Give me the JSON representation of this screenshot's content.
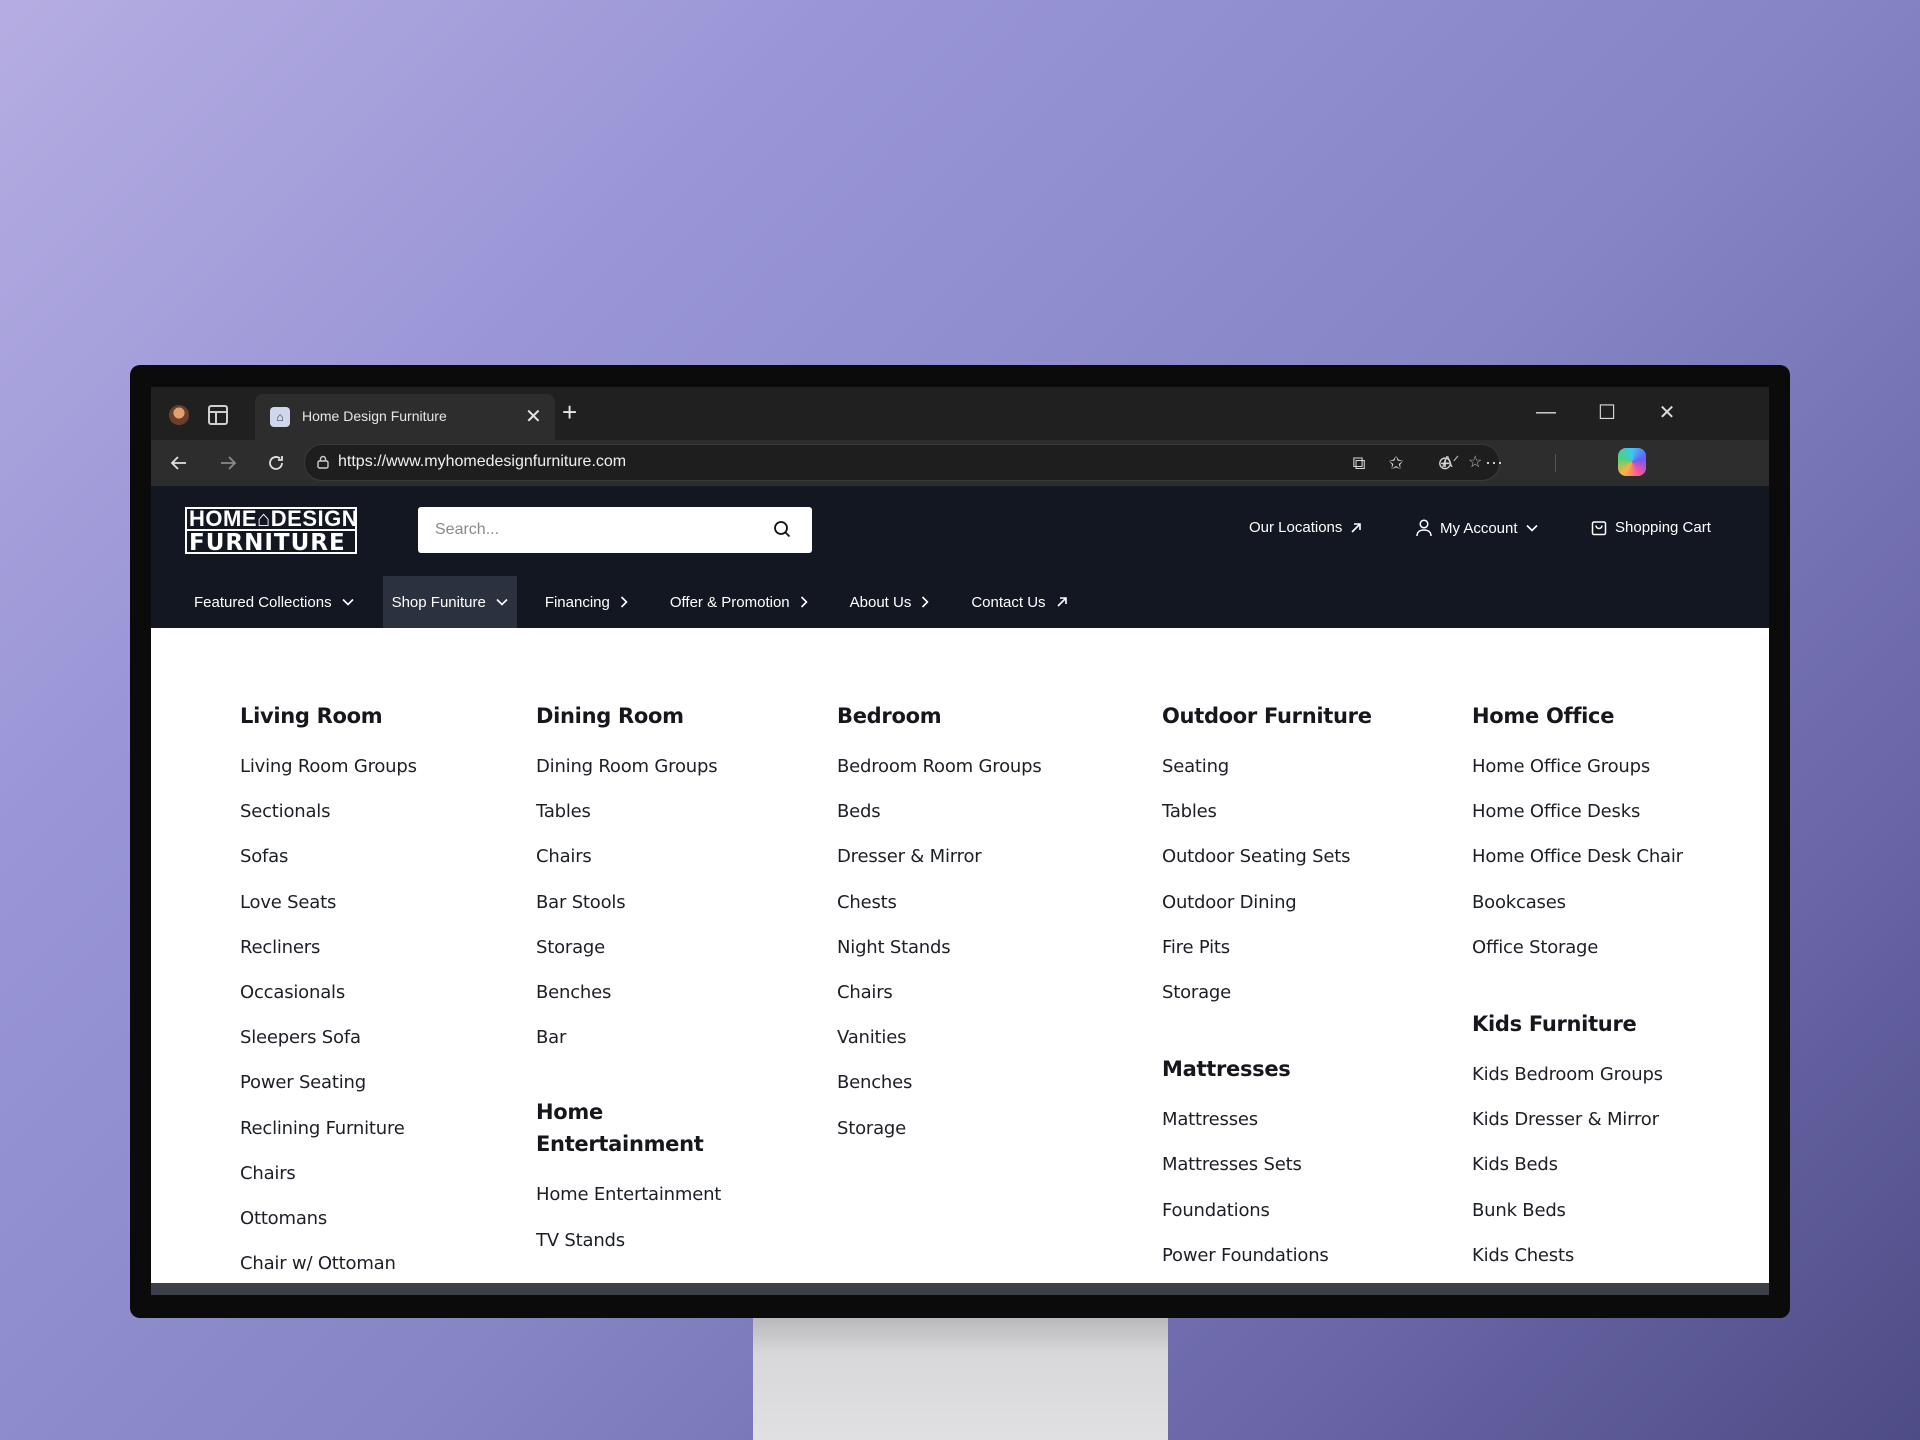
{
  "browser": {
    "tab_title": "Home Design Furniture",
    "url": "https://www.myhomedesignfurniture.com"
  },
  "site": {
    "logo_line1": "HOME⌂DESIGN",
    "logo_line2": "FURNITURE",
    "search_placeholder": "Search...",
    "header_links": {
      "locations": "Our Locations",
      "account": "My Account",
      "cart": "Shopping Cart"
    },
    "nav": [
      {
        "label": "Featured Collections"
      },
      {
        "label": "Shop Funiture"
      },
      {
        "label": "Financing"
      },
      {
        "label": "Offer & Promotion"
      },
      {
        "label": "About Us"
      },
      {
        "label": "Contact Us"
      }
    ]
  },
  "mega_menu": {
    "living_room": {
      "title": "Living Room",
      "items": [
        "Living Room Groups",
        "Sectionals",
        "Sofas",
        "Love Seats",
        "Recliners",
        "Occasionals",
        "Sleepers Sofa",
        "Power Seating",
        "Reclining Furniture",
        "Chairs",
        "Ottomans",
        "Chair w/ Ottoman"
      ]
    },
    "dining_room": {
      "title": "Dining Room",
      "items": [
        "Dining Room Groups",
        "Tables",
        "Chairs",
        "Bar Stools",
        "Storage",
        "Benches",
        "Bar"
      ]
    },
    "home_entertainment": {
      "title_line1": "Home",
      "title_line2": "Entertainment",
      "items": [
        "Home Entertainment",
        "TV Stands"
      ]
    },
    "bedroom": {
      "title": "Bedroom",
      "items": [
        "Bedroom Room Groups",
        "Beds",
        "Dresser & Mirror",
        "Chests",
        "Night Stands",
        "Chairs",
        "Vanities",
        "Benches",
        "Storage"
      ]
    },
    "outdoor": {
      "title": "Outdoor Furniture",
      "items": [
        "Seating",
        "Tables",
        "Outdoor Seating Sets",
        "Outdoor Dining",
        "Fire Pits",
        "Storage"
      ]
    },
    "mattresses": {
      "title": "Mattresses",
      "items": [
        "Mattresses",
        "Mattresses Sets",
        "Foundations",
        "Power Foundations"
      ]
    },
    "home_office": {
      "title": "Home Office",
      "items": [
        "Home Office Groups",
        "Home Office Desks",
        "Home Office Desk Chair",
        "Bookcases",
        "Office Storage"
      ]
    },
    "kids": {
      "title": "Kids Furniture",
      "items": [
        "Kids Bedroom Groups",
        "Kids Dresser & Mirror",
        "Kids Beds",
        "Bunk Beds",
        "Kids Chests"
      ]
    }
  }
}
